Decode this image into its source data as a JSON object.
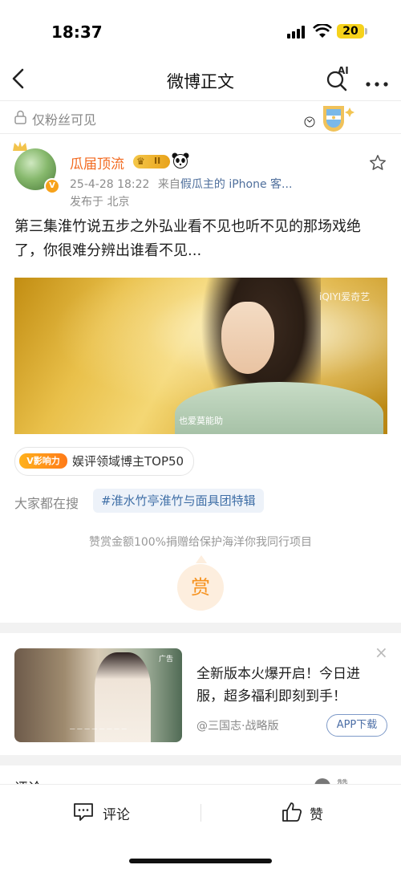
{
  "status_bar": {
    "time": "18:37",
    "battery": "20"
  },
  "nav": {
    "title": "微博正文",
    "ai_label": "AI"
  },
  "visibility": {
    "text": "仅粉丝可见"
  },
  "post": {
    "username": "瓜届顶流",
    "level_badge": "II",
    "date": "25-4-28 18:22",
    "source_prefix": "来自",
    "source": "假瓜主的 iPhone 客...",
    "location": "发布于 北京",
    "text": "第三集淮竹说五步之外弘业看不见也听不见的那场戏绝了，你很难分辨出谁看不见...",
    "media": {
      "watermark": "iQIYI爱奇艺",
      "subtitle": "也爱莫能助"
    }
  },
  "tag": {
    "logo": "V影响力",
    "text": "娱评领域博主TOP50"
  },
  "search": {
    "label": "大家都在搜",
    "chip": "#淮水竹亭淮竹与面具团特辑"
  },
  "reward": {
    "text": "赞赏金额100%捐赠给保护海洋你我同行项目",
    "button": "赏"
  },
  "ad": {
    "text": "全新版本火爆开启！今日进服，超多福利即刻到手！",
    "source": "@三国志·战略版",
    "button": "APP下载",
    "tag": "广告",
    "close": "×"
  },
  "comments_peek": {
    "label": "评论",
    "likes_label": "赞"
  },
  "bottom_bar": {
    "comment": "评论",
    "like": "赞"
  },
  "colors": {
    "accent_orange": "#f26a20",
    "link_blue": "#4f6f9c",
    "gold": "#f5c84a"
  }
}
